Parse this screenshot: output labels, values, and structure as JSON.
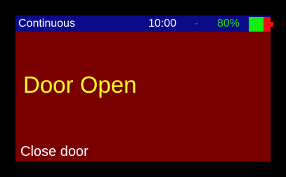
{
  "status_bar": {
    "mode": "Continuous",
    "time": "10:00",
    "separator": "-",
    "battery_percent_text": "80%",
    "battery_level": 0.8,
    "colors": {
      "background": "#0a0a88",
      "mode_text": "#ffffff",
      "time_text": "#ffffff",
      "separator_text": "#ff2020",
      "battery_text": "#22dd22",
      "battery_fill": "#11ee11",
      "battery_empty": "#ee1111"
    }
  },
  "screen": {
    "background": "#7a0000",
    "message": "Door Open",
    "message_color": "#ffff22",
    "action_label": "Close door",
    "action_color": "#ffffff"
  },
  "icons": [
    "battery-icon"
  ]
}
